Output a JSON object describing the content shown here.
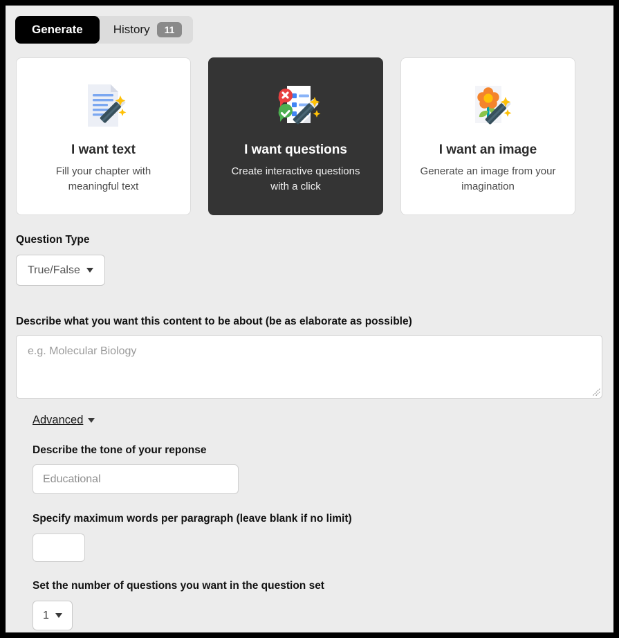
{
  "tabs": {
    "generate_label": "Generate",
    "history_label": "History",
    "history_count": "11"
  },
  "cards": [
    {
      "icon": "document-wand-icon",
      "title": "I want text",
      "desc": "Fill your chapter with meaningful text",
      "selected": false
    },
    {
      "icon": "quiz-wand-icon",
      "title": "I want questions",
      "desc": "Create interactive questions with a click",
      "selected": true
    },
    {
      "icon": "flower-wand-icon",
      "title": "I want an image",
      "desc": "Generate an image from your imagination",
      "selected": false
    }
  ],
  "form": {
    "question_type_label": "Question Type",
    "question_type_value": "True/False",
    "prompt_label": "Describe what you want this content to be about (be as elaborate as possible)",
    "prompt_placeholder": "e.g. Molecular Biology",
    "prompt_value": "",
    "advanced_label": "Advanced",
    "tone_label": "Describe the tone of your reponse",
    "tone_placeholder": "Educational",
    "tone_value": "",
    "max_words_label": "Specify maximum words per paragraph (leave blank if no limit)",
    "max_words_value": "",
    "question_count_label": "Set the number of questions you want in the question set",
    "question_count_value": "1"
  },
  "colors": {
    "accent_dark": "#343434",
    "page_bg": "#ececec",
    "badge_gray": "#8a8a8a",
    "icon_blue": "#4285f4",
    "icon_red": "#e84040",
    "icon_green": "#4caf50",
    "icon_yellow": "#ffc творb00"
  }
}
